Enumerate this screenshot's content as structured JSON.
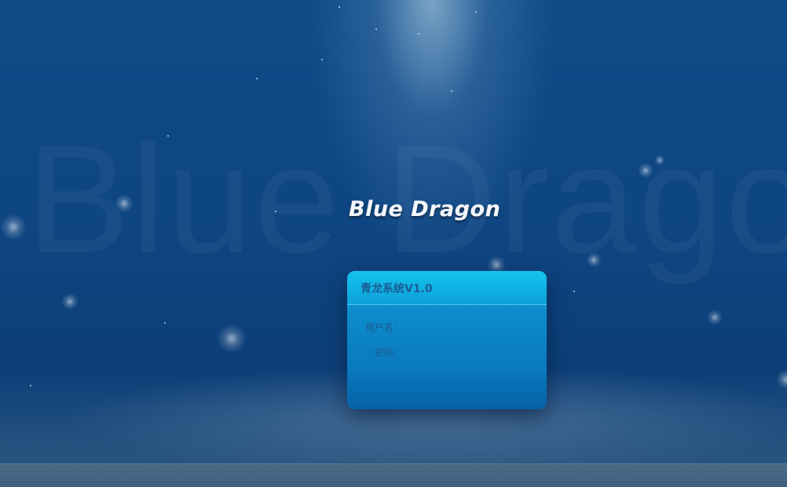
{
  "background": {
    "watermark_text": "Blue Dragon"
  },
  "logo": {
    "text": "Blue Dragon"
  },
  "login": {
    "title": "青龙系统V1.0",
    "username_label": "用户名：",
    "username_value": "",
    "password_label": "密码：",
    "password_value": ""
  },
  "colors": {
    "background": "#0e4683",
    "panel": "#0a79bd",
    "panel_header": "#10afe2",
    "label_text": "#1d5c8f",
    "footer": "#456683"
  }
}
